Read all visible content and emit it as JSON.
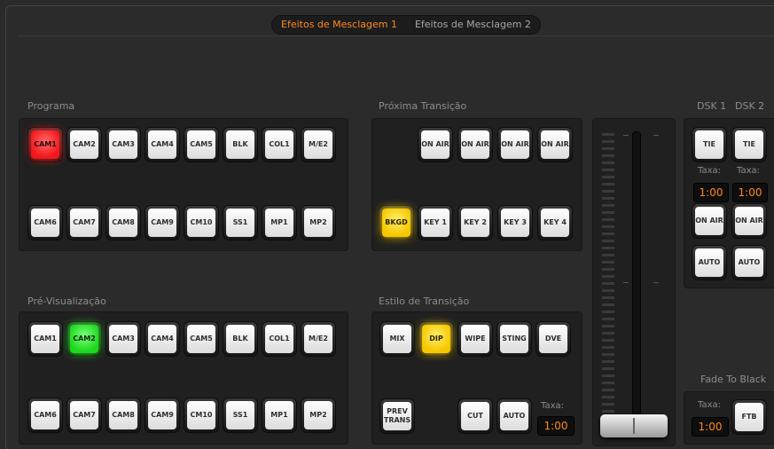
{
  "tabs": [
    {
      "label": "Efeitos de Mesclagem 1",
      "active": true
    },
    {
      "label": "Efeitos de Mesclagem 2",
      "active": false
    }
  ],
  "program": {
    "label": "Programa",
    "row1": [
      "CAM1",
      "CAM2",
      "CAM3",
      "CAM4",
      "CAM5",
      "BLK",
      "COL1",
      "M/E2"
    ],
    "row2": [
      "CAM6",
      "CAM7",
      "CAM8",
      "CAM9",
      "CM10",
      "SS1",
      "MP1",
      "MP2"
    ],
    "active": "CAM1"
  },
  "preview": {
    "label": "Pré-Visualização",
    "row1": [
      "CAM1",
      "CAM2",
      "CAM3",
      "CAM4",
      "CAM5",
      "BLK",
      "COL1",
      "M/E2"
    ],
    "row2": [
      "CAM6",
      "CAM7",
      "CAM8",
      "CAM9",
      "CM10",
      "SS1",
      "MP1",
      "MP2"
    ],
    "active": "CAM2"
  },
  "next_transition": {
    "label": "Próxima Transição",
    "on_air": [
      "ON AIR",
      "ON AIR",
      "ON AIR",
      "ON AIR"
    ],
    "layers": [
      "BKGD",
      "KEY 1",
      "KEY 2",
      "KEY 3",
      "KEY 4"
    ],
    "active": "BKGD"
  },
  "transition_style": {
    "label": "Estilo de Transição",
    "styles": [
      "MIX",
      "DIP",
      "WIPE",
      "STING",
      "DVE"
    ],
    "active": "DIP",
    "prev_trans": "PREV TRANS",
    "cut": "CUT",
    "auto": "AUTO",
    "rate_label": "Taxa:",
    "rate": "1:00"
  },
  "dsk": {
    "dsk1_label": "DSK 1",
    "dsk2_label": "DSK 2",
    "tie": "TIE",
    "rate_label": "Taxa:",
    "rate1": "1:00",
    "rate2": "1:00",
    "on_air": "ON AIR",
    "auto": "AUTO"
  },
  "ftb": {
    "label": "Fade To Black",
    "rate_label": "Taxa:",
    "rate": "1:00",
    "button": "FTB"
  },
  "colors": {
    "accent": "#ff8a1f",
    "program_active": "#f2171b",
    "preview_active": "#1ed81e",
    "selected": "#f5c700"
  }
}
